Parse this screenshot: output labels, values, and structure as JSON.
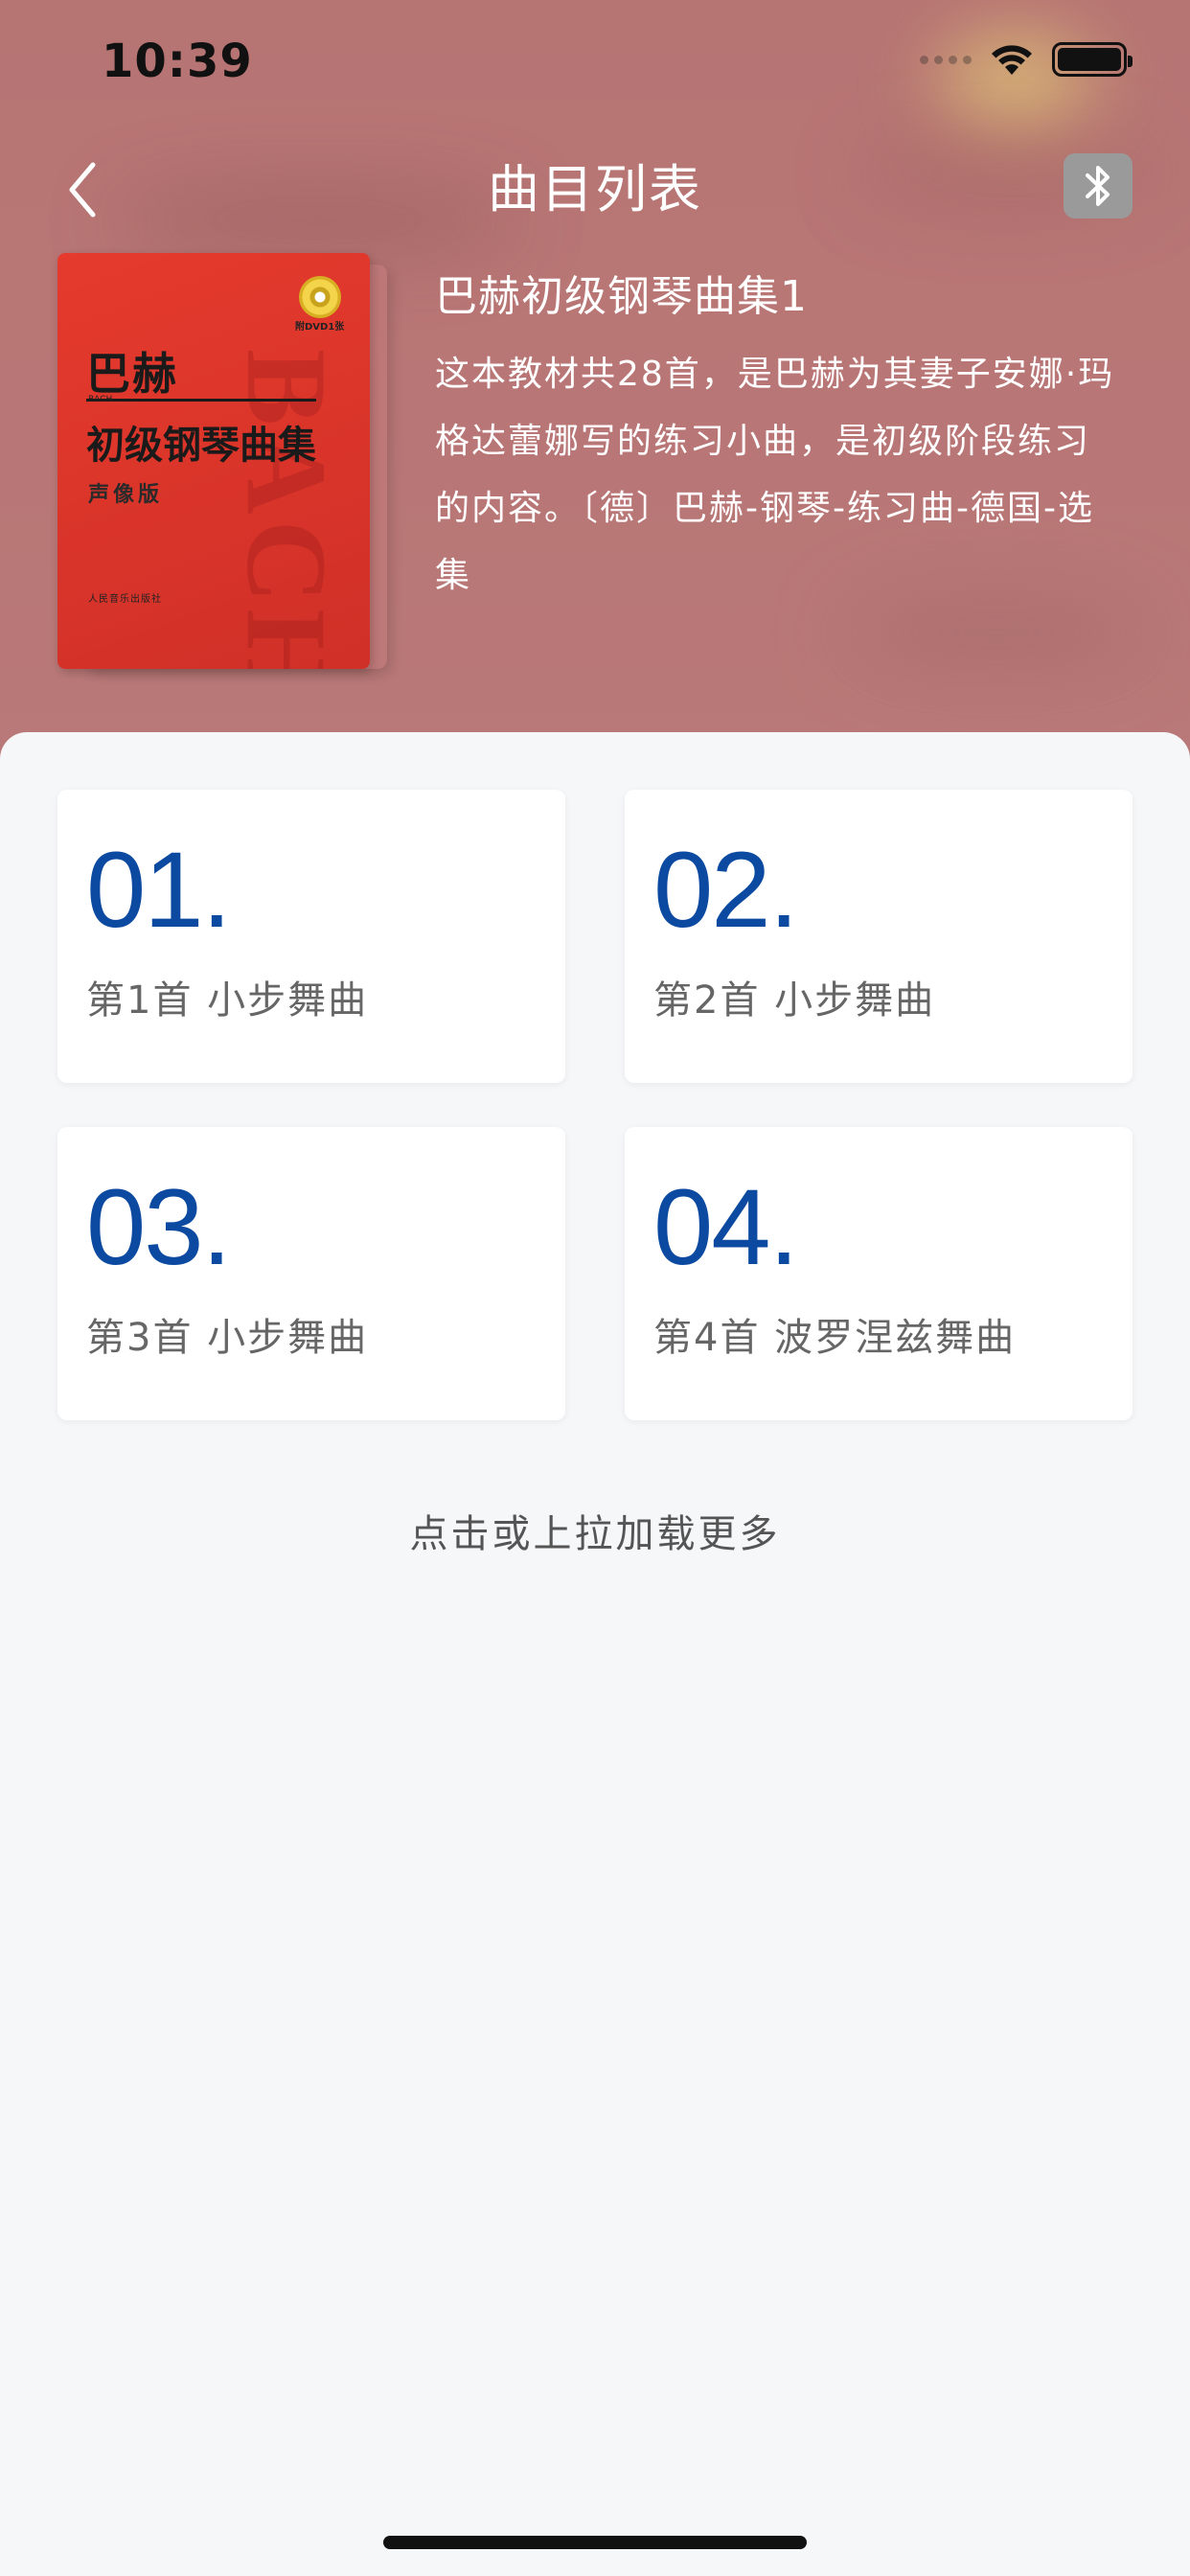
{
  "status_bar": {
    "time": "10:39"
  },
  "nav": {
    "title": "曲目列表",
    "back_icon": "chevron-left-icon",
    "bluetooth_icon": "bluetooth-icon"
  },
  "book": {
    "cover": {
      "title_line1": "巴赫",
      "subtitle_small": "BACH",
      "title_line2": "初级钢琴曲集",
      "edition": "声像版",
      "publisher": "人民音乐出版社",
      "dvd_label": "附DVD1张",
      "watermark": "BACH"
    },
    "title": "巴赫初级钢琴曲集1",
    "description": "这本教材共28首，是巴赫为其妻子安娜·玛格达蕾娜写的练习小曲，是初级阶段练习的内容。〔德〕巴赫-钢琴-练习曲-德国-选集"
  },
  "tracks": [
    {
      "number": "01.",
      "name": "第1首 小步舞曲"
    },
    {
      "number": "02.",
      "name": "第2首 小步舞曲"
    },
    {
      "number": "03.",
      "name": "第3首 小步舞曲"
    },
    {
      "number": "04.",
      "name": "第4首 波罗涅兹舞曲"
    }
  ],
  "load_more": "点击或上拉加载更多",
  "colors": {
    "accent": "#0b4aa0",
    "hero_bg": "#b67473",
    "page_bg": "#f6f7f9"
  }
}
